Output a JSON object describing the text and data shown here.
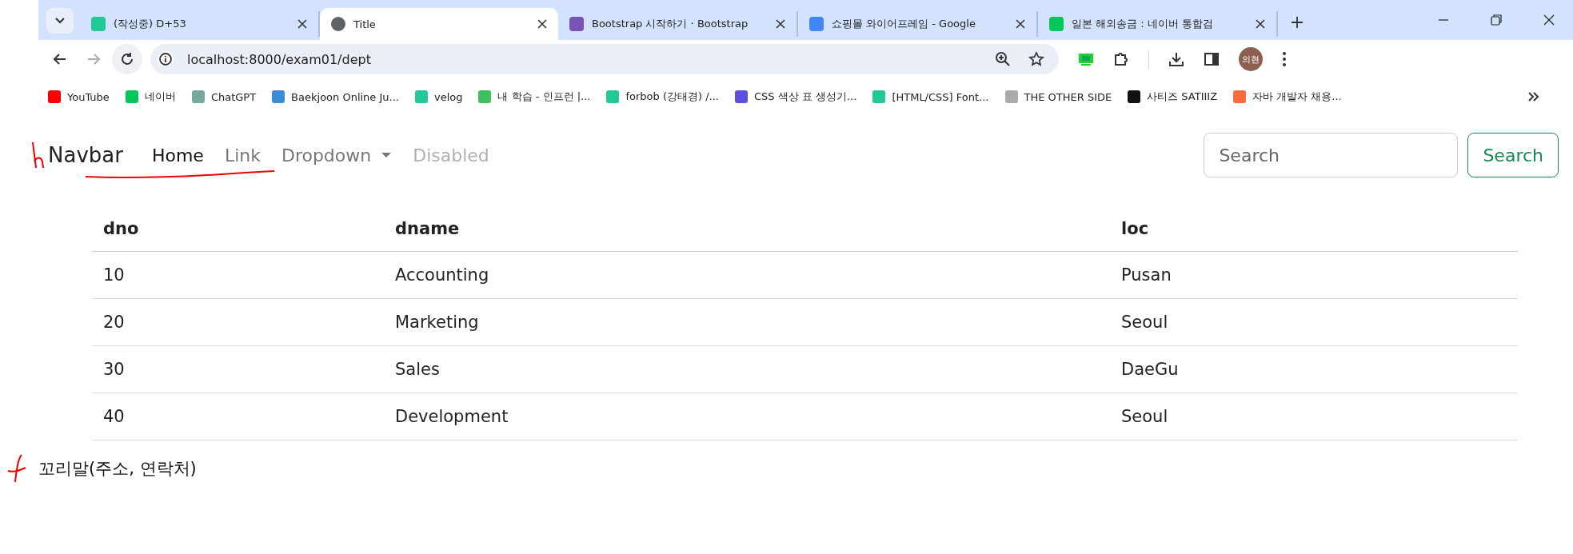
{
  "browser": {
    "tabs": [
      {
        "title": "(작성중) D+53",
        "selected": false,
        "color": "#20c997"
      },
      {
        "title": "Title",
        "selected": true,
        "color": "#5f6368"
      },
      {
        "title": "Bootstrap 시작하기 · Bootstrap",
        "selected": false,
        "color": "#7952b3"
      },
      {
        "title": "쇼핑몰 와이어프레임 - Google",
        "selected": false,
        "color": "#4285f4"
      },
      {
        "title": "일본 해외송금 : 네이버 통합검",
        "selected": false,
        "color": "#03c75a"
      }
    ],
    "url": "localhost:8000/exam01/dept",
    "profile": "의현",
    "bookmarks": [
      {
        "label": "YouTube",
        "color": "#ff0000"
      },
      {
        "label": "네이버",
        "color": "#03c75a"
      },
      {
        "label": "ChatGPT",
        "color": "#74aa9c"
      },
      {
        "label": "Baekjoon Online Ju...",
        "color": "#3b8bd9"
      },
      {
        "label": "velog",
        "color": "#20c997"
      },
      {
        "label": "내 학습 - 인프런 |...",
        "color": "#3fbf5f"
      },
      {
        "label": "forbob (강태경) /...",
        "color": "#20c997"
      },
      {
        "label": "CSS 색상 표 생성기...",
        "color": "#5b4fe0"
      },
      {
        "label": "[HTML/CSS] Font...",
        "color": "#20c997"
      },
      {
        "label": "THE OTHER SIDE",
        "color": "#aaaaaa"
      },
      {
        "label": "사티즈 SATIIIZ",
        "color": "#111111"
      },
      {
        "label": "자바 개발자 채용...",
        "color": "#ff6b3d"
      }
    ]
  },
  "navbar": {
    "brand": "Navbar",
    "items": [
      {
        "label": "Home",
        "kind": "link",
        "active": true,
        "disabled": false
      },
      {
        "label": "Link",
        "kind": "link",
        "active": false,
        "disabled": false
      },
      {
        "label": "Dropdown",
        "kind": "dropdown",
        "active": false,
        "disabled": false
      },
      {
        "label": "Disabled",
        "kind": "link",
        "active": false,
        "disabled": true
      }
    ],
    "search": {
      "placeholder": "Search"
    },
    "search_button": "Search"
  },
  "table": {
    "columns": [
      "dno",
      "dname",
      "loc"
    ],
    "rows": [
      [
        "10",
        "Accounting",
        "Pusan"
      ],
      [
        "20",
        "Marketing",
        "Seoul"
      ],
      [
        "30",
        "Sales",
        "DaeGu"
      ],
      [
        "40",
        "Development",
        "Seoul"
      ]
    ]
  },
  "footer": "꼬리말(주소, 연락처)"
}
